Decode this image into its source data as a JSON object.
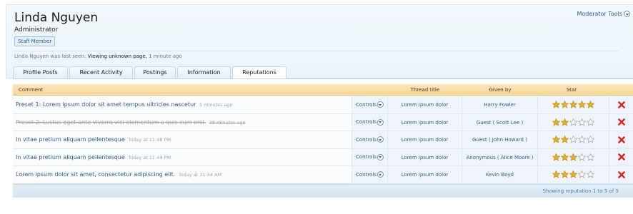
{
  "profile": {
    "name": "Linda Nguyen",
    "role": "Administrator",
    "badge": "Staff Member",
    "moderator_tools": "Moderator Tools",
    "last_seen_prefix": "Linda Nguyen was last seen:",
    "last_seen_action": "Viewing unknown page,",
    "last_seen_time": "1 minute ago"
  },
  "tabs": [
    {
      "label": "Profile Posts",
      "active": false
    },
    {
      "label": "Recent Activity",
      "active": false
    },
    {
      "label": "Postings",
      "active": false
    },
    {
      "label": "Information",
      "active": false
    },
    {
      "label": "Reputations",
      "active": true
    }
  ],
  "table": {
    "headers": {
      "comment": "Comment",
      "thread_title": "Thread title",
      "given_by": "Given by",
      "star": "Star"
    },
    "controls_label": "Controls",
    "rows": [
      {
        "comment": "Preset 1: Lorem ipsum dolor sit amet tempus ultricies nascetur",
        "time": "5 minutes ago",
        "thread": "Lorem ipsum dolor",
        "given_by": "Harry Fowler",
        "rating": 5,
        "deleted": false
      },
      {
        "comment": "Preset 2: Luctus eget ante viverra vici elementum a quis cum orci.",
        "time": "38 minutes ago",
        "thread": "Lorem ipsum dolor",
        "given_by": "Guest ( Scott Lee )",
        "rating": 2,
        "deleted": true
      },
      {
        "comment": "In vitae pretium aliquam pellentesque",
        "time": "Today at 11:48 PM",
        "thread": "Lorem ipsum dolor",
        "given_by": "Guest ( John Howard )",
        "rating": 2,
        "deleted": false
      },
      {
        "comment": "In vitae pretium aliquam pellentesque",
        "time": "Today at 11:44 PM",
        "thread": "Lorem ipsum dolor",
        "given_by": "Anonymous ( Alice Moore )",
        "rating": 3,
        "deleted": false
      },
      {
        "comment": "Lorem ipsum dolor sit amet, consectetur adipiscing elit.",
        "time": "Today at 11:44 AM",
        "thread": "Lorem ipsum dolor",
        "given_by": "Kevin Boyd",
        "rating": 3,
        "deleted": false
      }
    ],
    "max_rating": 5,
    "footer": "Showing reputation 1 to 5 of 5"
  },
  "colors": {
    "star_filled": "#f1b01c",
    "star_empty": "#ffffff",
    "star_stroke": "#b8902a",
    "star_empty_stroke": "#a9a9a9",
    "delete": "#d8262a"
  }
}
